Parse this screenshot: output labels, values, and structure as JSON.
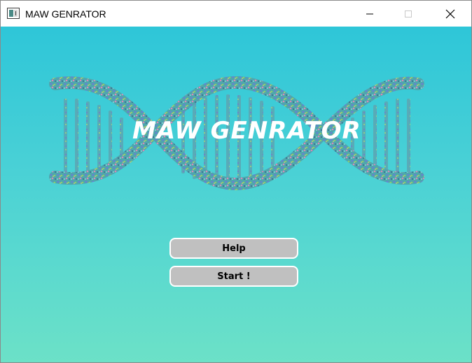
{
  "window": {
    "title": "MAW GENRATOR",
    "icon": "app-window-icon",
    "controls": {
      "minimize_icon": "minimize-icon",
      "maximize_icon": "maximize-icon",
      "close_icon": "close-icon"
    }
  },
  "main": {
    "logo_text": "MAW GENRATOR",
    "logo_graphic": "dna-helix-image",
    "buttons": {
      "help_label": "Help",
      "start_label": "Start !"
    }
  },
  "colors": {
    "background_top": "#2ec6d8",
    "background_bottom": "#6ce1c7",
    "button_fill": "#c0c0c0",
    "button_border": "#ffffff",
    "logo_text": "#ffffff"
  }
}
